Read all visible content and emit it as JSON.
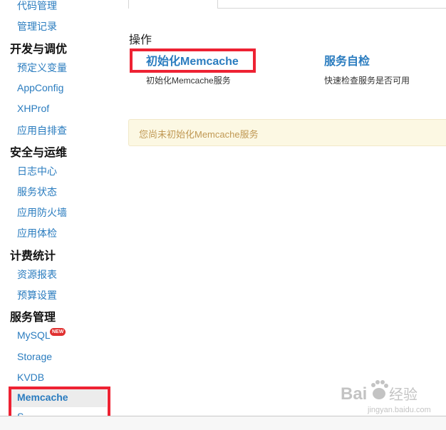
{
  "sidebar": {
    "items": [
      {
        "label": "代码管理",
        "kind": "link"
      },
      {
        "label": "管理记录",
        "kind": "link"
      },
      {
        "label": "开发与调优",
        "kind": "heading"
      },
      {
        "label": "预定义变量",
        "kind": "link"
      },
      {
        "label": "AppConfig",
        "kind": "link"
      },
      {
        "label": "XHProf",
        "kind": "link"
      },
      {
        "label": "应用自排查",
        "kind": "link"
      },
      {
        "label": "安全与运维",
        "kind": "heading"
      },
      {
        "label": "日志中心",
        "kind": "link"
      },
      {
        "label": "服务状态",
        "kind": "link"
      },
      {
        "label": "应用防火墙",
        "kind": "link"
      },
      {
        "label": "应用体检",
        "kind": "link"
      },
      {
        "label": "计费统计",
        "kind": "heading"
      },
      {
        "label": "资源报表",
        "kind": "link"
      },
      {
        "label": "预算设置",
        "kind": "link"
      },
      {
        "label": "服务管理",
        "kind": "heading"
      },
      {
        "label": "MySQL",
        "kind": "link"
      },
      {
        "label": "Storage",
        "kind": "link"
      },
      {
        "label": "KVDB",
        "kind": "link"
      },
      {
        "label": "Memcache",
        "kind": "active"
      }
    ],
    "mysql_badge": "NEW",
    "active_color": "#ececec",
    "link_color": "#2a7cbf"
  },
  "main": {
    "section_title": "操作",
    "operations": [
      {
        "label": "初始化Memcache",
        "desc": "初始化Memcache服务"
      },
      {
        "label": "服务自检",
        "desc": "快速检查服务是否可用"
      }
    ],
    "notice": "您尚未初始化Memcache服务",
    "notice_bg": "#fcf8e3",
    "notice_color": "#c09853"
  },
  "watermark": {
    "brand": "Bai",
    "brand_suffix": "经验",
    "url": "jingyan.baidu.com",
    "icon": "baidu-paw-icon"
  },
  "highlight_color": "#ee2233"
}
